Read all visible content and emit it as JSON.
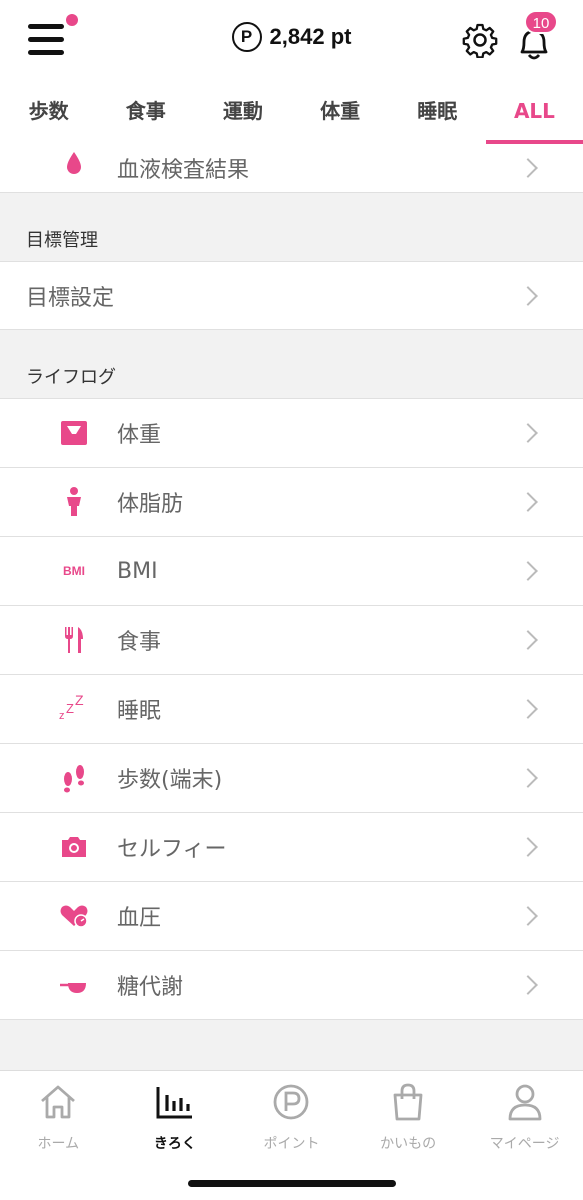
{
  "header": {
    "points": "2,842 pt",
    "points_icon_letter": "P",
    "notification_count": "10"
  },
  "tabs": [
    {
      "label": "歩数"
    },
    {
      "label": "食事"
    },
    {
      "label": "運動"
    },
    {
      "label": "体重"
    },
    {
      "label": "睡眠"
    },
    {
      "label": "ALL",
      "active": true
    }
  ],
  "top_item": {
    "label": "血液検査結果",
    "icon": "blood-drop-icon"
  },
  "goal_section": {
    "title": "目標管理",
    "items": [
      {
        "label": "目標設定"
      }
    ]
  },
  "lifelog_section": {
    "title": "ライフログ",
    "items": [
      {
        "label": "体重",
        "icon": "scale-icon"
      },
      {
        "label": "体脂肪",
        "icon": "body-fat-icon"
      },
      {
        "label": "BMI",
        "icon": "bmi-icon",
        "icon_text": "BMI"
      },
      {
        "label": "食事",
        "icon": "fork-knife-icon"
      },
      {
        "label": "睡眠",
        "icon": "sleep-zzz-icon",
        "icon_text": "zZZ"
      },
      {
        "label": "歩数(端末)",
        "icon": "footprints-icon"
      },
      {
        "label": "セルフィー",
        "icon": "camera-icon"
      },
      {
        "label": "血圧",
        "icon": "heart-gauge-icon"
      },
      {
        "label": "糖代謝",
        "icon": "glucose-icon"
      }
    ]
  },
  "bottom_nav": [
    {
      "label": "ホーム",
      "icon": "home-icon"
    },
    {
      "label": "きろく",
      "icon": "chart-bars-icon",
      "active": true
    },
    {
      "label": "ポイント",
      "icon": "points-icon"
    },
    {
      "label": "かいもの",
      "icon": "shopping-bag-icon"
    },
    {
      "label": "マイページ",
      "icon": "user-icon"
    }
  ],
  "colors": {
    "accent": "#e8488a",
    "text": "#333333",
    "muted": "#aaaaaa"
  }
}
